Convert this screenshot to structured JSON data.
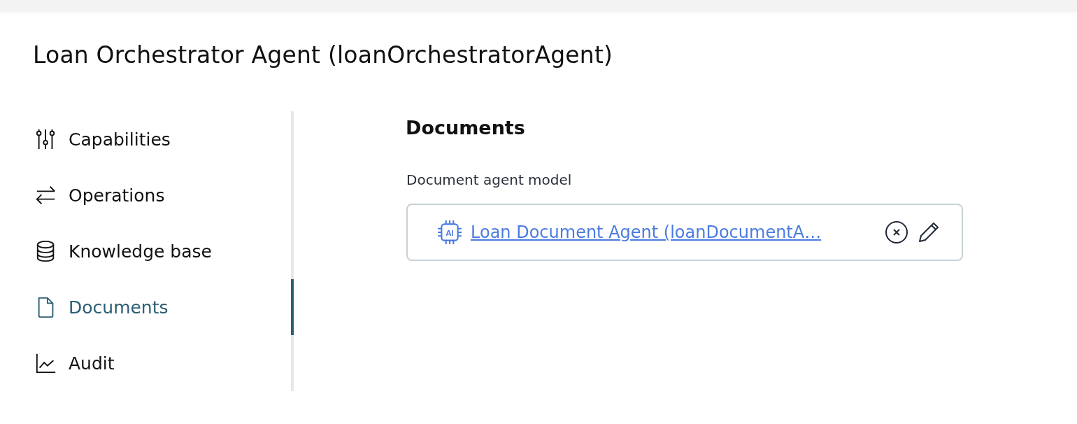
{
  "title": "Loan Orchestrator Agent (loanOrchestratorAgent)",
  "sidebar": {
    "items": [
      {
        "label": "Capabilities",
        "selected": false
      },
      {
        "label": "Operations",
        "selected": false
      },
      {
        "label": "Knowledge base",
        "selected": false
      },
      {
        "label": "Documents",
        "selected": true
      },
      {
        "label": "Audit",
        "selected": false
      }
    ]
  },
  "section": {
    "heading": "Documents",
    "field": {
      "label": "Document agent model",
      "icon_label": "AI",
      "value": "Loan Document Agent (loanDocumentA…"
    }
  }
}
